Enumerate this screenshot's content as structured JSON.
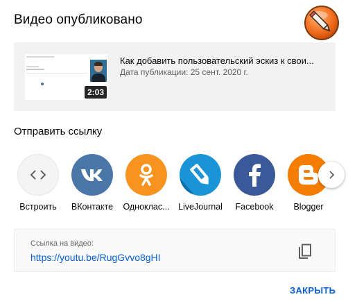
{
  "dialog": {
    "title": "Видео опубликовано",
    "logo_icon": "pencil-circle-logo"
  },
  "video": {
    "title": "Как добавить пользовательский эскиз к свои...",
    "date": "Дата публикации: 25 сент. 2020 г.",
    "duration": "2:03"
  },
  "share": {
    "heading": "Отправить ссылку",
    "items": [
      {
        "label": "Встроить",
        "icon": "embed-code-icon",
        "color": "#f4f4f4"
      },
      {
        "label": "ВКонтакте",
        "icon": "vk-icon",
        "color": "#4a76a8"
      },
      {
        "label": "Одноклассники",
        "icon": "odnoklassniki-icon",
        "color": "#f7931e"
      },
      {
        "label": "LiveJournal",
        "icon": "livejournal-icon",
        "color": "#1a94d6"
      },
      {
        "label": "Facebook",
        "icon": "facebook-icon",
        "color": "#3b5998"
      },
      {
        "label": "Blogger",
        "icon": "blogger-icon",
        "color": "#f57d00"
      }
    ],
    "next_icon": "chevron-right-icon"
  },
  "link": {
    "caption": "Ссылка на видео:",
    "url": "https://youtu.be/RugGvvo8gHI",
    "copy_icon": "copy-icon"
  },
  "footer": {
    "close_label": "ЗАКРЫТЬ"
  },
  "colors": {
    "accent": "#065fd4",
    "card_bg": "#f2f2f2"
  }
}
